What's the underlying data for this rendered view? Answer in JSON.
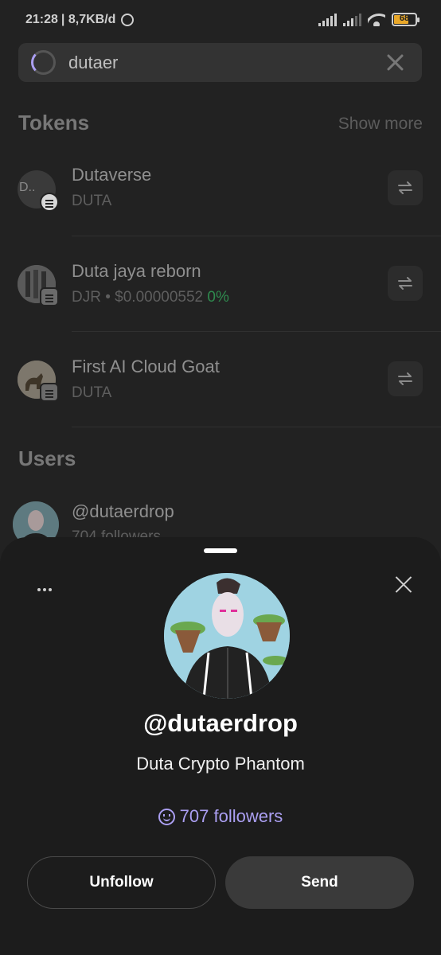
{
  "status_bar": {
    "time": "21:28",
    "speed": "| 8,7KB/d",
    "battery": "68"
  },
  "search": {
    "value": "dutaer"
  },
  "tokens": {
    "title": "Tokens",
    "show_more": "Show more",
    "items": [
      {
        "name": "Dutaverse",
        "avatar_text": "D..",
        "symbol": "DUTA",
        "price": "",
        "change": ""
      },
      {
        "name": "Duta jaya reborn",
        "avatar_text": "",
        "symbol": "DJR",
        "price": " • $0.00000552 ",
        "change": "0%"
      },
      {
        "name": "First AI Cloud Goat",
        "avatar_text": "",
        "symbol": "DUTA",
        "price": "",
        "change": ""
      }
    ]
  },
  "users": {
    "title": "Users",
    "items": [
      {
        "handle": "@dutaerdrop",
        "followers": "704 followers"
      }
    ]
  },
  "profile_sheet": {
    "handle": "@dutaerdrop",
    "display_name": "Duta Crypto Phantom",
    "followers": "707 followers",
    "unfollow_label": "Unfollow",
    "send_label": "Send",
    "accent_color": "#ab9ff2"
  }
}
